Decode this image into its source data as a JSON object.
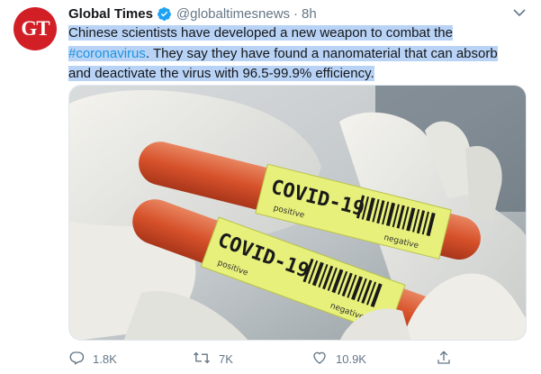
{
  "author": {
    "avatar_text": "GT",
    "name": "Global Times",
    "handle": "@globaltimesnews",
    "separator": "·",
    "time": "8h"
  },
  "tweet": {
    "text_part1": "Chinese scientists have developed a new weapon to combat the",
    "hashtag": "#coronavirus",
    "text_part2": ". They say they have found a nanomaterial that can absorb",
    "text_part3": "and deactivate the virus with 96.5-99.9% efficiency."
  },
  "media": {
    "tube1_label": "COVID-19",
    "tube2_label": "COVID-19",
    "positive_label": "positive",
    "negative_label": "negative"
  },
  "actions": {
    "replies": "1.8K",
    "retweets": "7K",
    "likes": "10.9K"
  },
  "colors": {
    "accent": "#1b95e0",
    "highlight": "#b9d3f6",
    "avatar_bg": "#d21f26",
    "muted": "#657786"
  },
  "icons": [
    "verified-badge-icon",
    "chevron-down-icon",
    "reply-icon",
    "retweet-icon",
    "like-icon",
    "share-icon"
  ]
}
